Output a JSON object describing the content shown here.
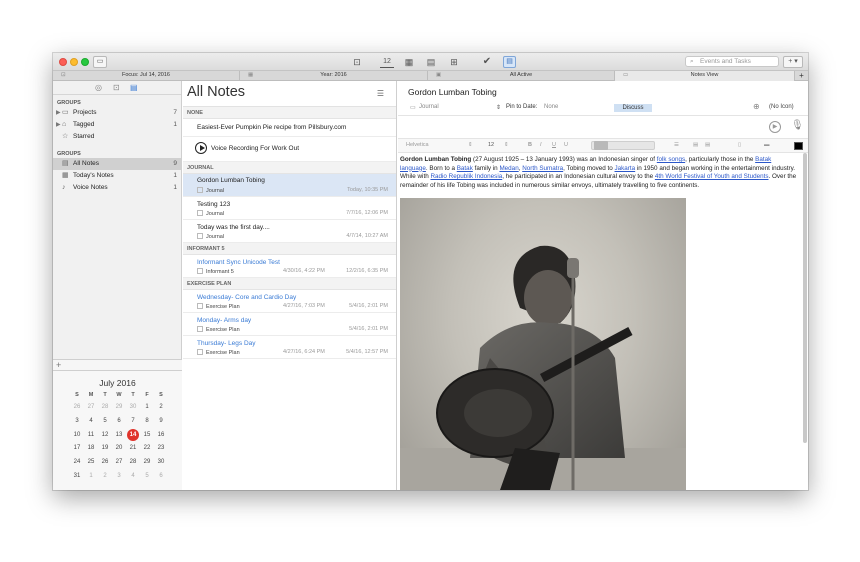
{
  "toolbar": {
    "count_badge": "12",
    "search_placeholder": "Events and Tasks",
    "add_label": "+ ▾"
  },
  "tabs": [
    {
      "label": "Focus: Jul 14, 2016"
    },
    {
      "label": "Year: 2016"
    },
    {
      "label": "All Active"
    },
    {
      "label": "Notes View"
    }
  ],
  "sidebar": {
    "group1_label": "GROUPS",
    "group1_items": [
      {
        "label": "Projects",
        "count": "7"
      },
      {
        "label": "Tagged",
        "count": "1"
      },
      {
        "label": "Starred",
        "count": ""
      }
    ],
    "group2_label": "GROUPS",
    "group2_items": [
      {
        "label": "All Notes",
        "count": "9"
      },
      {
        "label": "Today's Notes",
        "count": "1"
      },
      {
        "label": "Voice Notes",
        "count": "1"
      }
    ],
    "add_button": "+"
  },
  "calendar": {
    "title": "July 2016",
    "weekdays": [
      "S",
      "M",
      "T",
      "W",
      "T",
      "F",
      "S"
    ],
    "days": [
      "26",
      "27",
      "28",
      "29",
      "30",
      "1",
      "2",
      "3",
      "4",
      "5",
      "6",
      "7",
      "8",
      "9",
      "10",
      "11",
      "12",
      "13",
      "14",
      "15",
      "16",
      "17",
      "18",
      "19",
      "20",
      "21",
      "22",
      "23",
      "24",
      "25",
      "26",
      "27",
      "28",
      "29",
      "30",
      "31",
      "1",
      "2",
      "3",
      "4",
      "5",
      "6"
    ],
    "today": "14"
  },
  "list": {
    "title": "All Notes",
    "sections": {
      "none": "NONE",
      "journal": "JOURNAL",
      "informant": "INFORMANT 5",
      "exercise": "EXERCISE PLAN"
    },
    "notes": [
      {
        "title": "Easiest-Ever Pumpkin Pie recipe from Pillsbury.com"
      },
      {
        "title": "Voice Recording  For Work Out"
      },
      {
        "title": "Gordon Lumban Tobing",
        "book": "Journal",
        "date": "Today, 10:35 PM"
      },
      {
        "title": "Testing 123",
        "book": "Journal",
        "date": "7/7/16, 12:06 PM"
      },
      {
        "title": "Today was the first day....",
        "book": "Journal",
        "date": "4/7/14, 10:27 AM"
      },
      {
        "title": "Informant Sync Unicode Test",
        "book": "Informant 5",
        "date1": "4/30/16, 4:22 PM",
        "date": "12/2/16, 6:35 PM"
      },
      {
        "title": "Wednesday- Core and Cardio Day",
        "book": "Exercise Plan",
        "date1": "4/27/16, 7:03 PM",
        "date": "5/4/16, 2:01 PM"
      },
      {
        "title": "Monday- Arms day",
        "book": "Exercise Plan",
        "date": "5/4/16, 2:01 PM"
      },
      {
        "title": "Thursday- Legs Day",
        "book": "Exercise Plan",
        "date1": "4/27/16, 6:24 PM",
        "date": "5/4/16, 12:57 PM"
      }
    ]
  },
  "detail": {
    "title": "Gordon Lumban Tobing",
    "notebook": "Journal",
    "pin_label": "Pin to Date:",
    "pin_value": "None",
    "discuss": "Discuss",
    "icon_label": "(No Icon)",
    "font_name": "Helvetica",
    "font_size": "12",
    "body": {
      "name": "Gordon Lumban Tobing",
      "t1": " (27 August 1925 – 13 January 1993) was an Indonesian singer of ",
      "l_folk": "folk songs",
      "t2": ", particularly those in the ",
      "l_batak_lang": "Batak language",
      "t3": ". Born to a ",
      "l_batak": "Batak",
      "t4": " family in ",
      "l_medan": "Medan",
      "t5": ", ",
      "l_sumatra": "North Sumatra",
      "t6": ", Tobing moved to ",
      "l_jakarta": "Jakarta",
      "t7": " in 1950 and began working in the entertainment industry. While with ",
      "l_rri": "Radio Republik Indonesia",
      "t8": ", he participated in an Indonesian cultural envoy to the ",
      "l_festival": "4th World Festival of Youth and Students",
      "t9": ". Over the remainder of his life Tobing was included in numerous similar envoys, ultimately travelling to five continents."
    }
  }
}
